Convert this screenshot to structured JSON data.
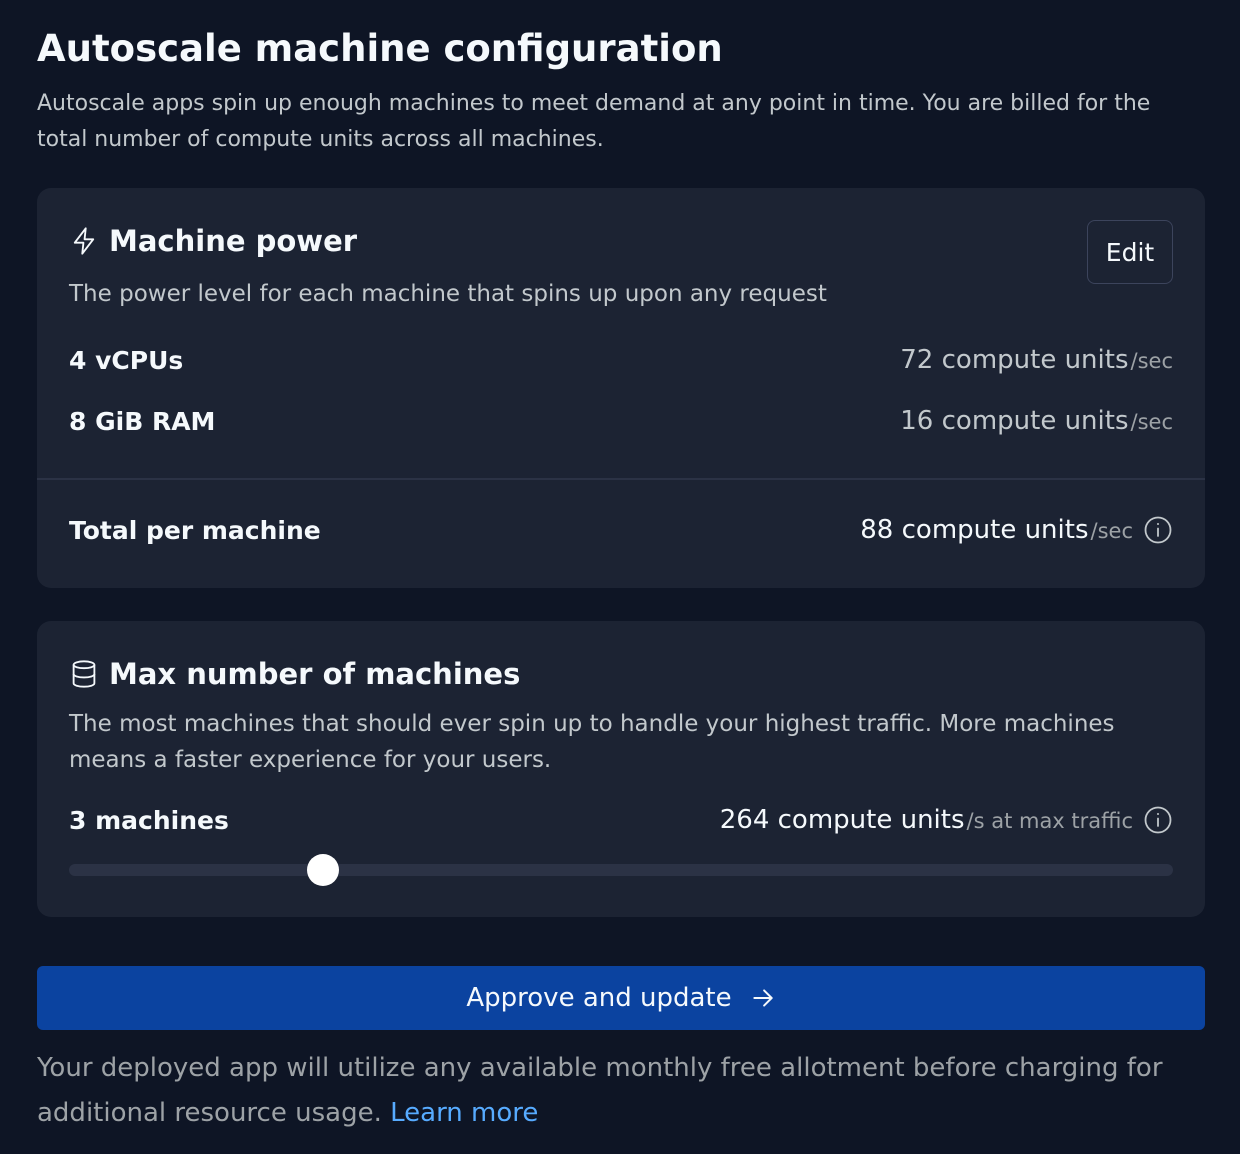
{
  "header": {
    "title": "Autoscale machine configuration",
    "subtitle": "Autoscale apps spin up enough machines to meet demand at any point in time. You are billed for the total number of compute units across all machines."
  },
  "machine_power": {
    "icon": "lightning-icon",
    "title": "Machine power",
    "description": "The power level for each machine that spins up upon any request",
    "edit_label": "Edit",
    "rows": [
      {
        "label": "4 vCPUs",
        "value": "72 compute units",
        "unit": "/sec"
      },
      {
        "label": "8 GiB RAM",
        "value": "16 compute units",
        "unit": "/sec"
      }
    ],
    "total": {
      "label": "Total per machine",
      "value": "88 compute units",
      "unit": "/sec"
    }
  },
  "max_machines": {
    "icon": "database-icon",
    "title": "Max number of machines",
    "description": "The most machines that should ever spin up to handle your highest traffic. More machines means a faster experience for your users.",
    "count_label": "3 machines",
    "value": "264 compute units",
    "unit": "/s at max traffic",
    "slider_fraction": 0.23
  },
  "approve": {
    "label": "Approve and update",
    "icon": "arrow-right-icon"
  },
  "footer": {
    "text": "Your deployed app will utilize any available monthly free allotment before charging for additional resource usage.",
    "link": "Learn more"
  },
  "colors": {
    "background": "#0e1525",
    "card": "#1c2333",
    "primary_button": "#0b43a0",
    "link": "#57abff"
  }
}
